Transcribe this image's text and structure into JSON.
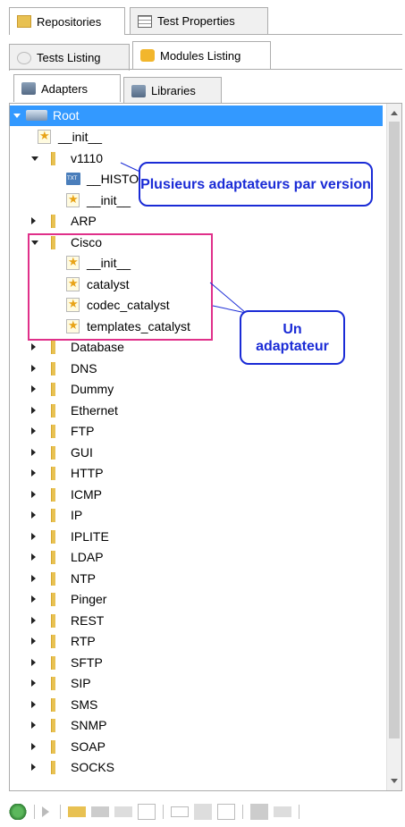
{
  "top_tabs": [
    {
      "label": "Repositories",
      "active": true
    },
    {
      "label": "Test Properties",
      "active": false
    }
  ],
  "second_tabs": [
    {
      "label": "Tests Listing",
      "active": false
    },
    {
      "label": "Modules Listing",
      "active": true
    }
  ],
  "third_tabs": [
    {
      "label": "Adapters",
      "active": true
    },
    {
      "label": "Libraries",
      "active": false
    }
  ],
  "tree": {
    "root": "Root",
    "items": [
      {
        "label": "__init__"
      },
      {
        "label": "v1110"
      },
      {
        "label": "__HISTORY"
      },
      {
        "label": "__init__"
      },
      {
        "label": "ARP"
      },
      {
        "label": "Cisco"
      },
      {
        "label": "__init__"
      },
      {
        "label": "catalyst"
      },
      {
        "label": "codec_catalyst"
      },
      {
        "label": "templates_catalyst"
      },
      {
        "label": "Database"
      },
      {
        "label": "DNS"
      },
      {
        "label": "Dummy"
      },
      {
        "label": "Ethernet"
      },
      {
        "label": "FTP"
      },
      {
        "label": "GUI"
      },
      {
        "label": "HTTP"
      },
      {
        "label": "ICMP"
      },
      {
        "label": "IP"
      },
      {
        "label": "IPLITE"
      },
      {
        "label": "LDAP"
      },
      {
        "label": "NTP"
      },
      {
        "label": "Pinger"
      },
      {
        "label": "REST"
      },
      {
        "label": "RTP"
      },
      {
        "label": "SFTP"
      },
      {
        "label": "SIP"
      },
      {
        "label": "SMS"
      },
      {
        "label": "SNMP"
      },
      {
        "label": "SOAP"
      },
      {
        "label": "SOCKS"
      }
    ]
  },
  "callouts": {
    "versions": "Plusieurs adaptateurs par version",
    "adapter": "Un adaptateur"
  },
  "colors": {
    "selection": "#3399ff",
    "callout_border": "#1a2bd6",
    "highlight_border": "#e0308a",
    "folder": "#e8c152"
  },
  "toolbar_icons": [
    "refresh-icon",
    "run-icon",
    "new-folder-icon",
    "delete-folder-icon",
    "rename-folder-icon",
    "new-file-icon",
    "open-icon",
    "copy-icon",
    "paste-icon",
    "print-icon",
    "export-icon"
  ]
}
